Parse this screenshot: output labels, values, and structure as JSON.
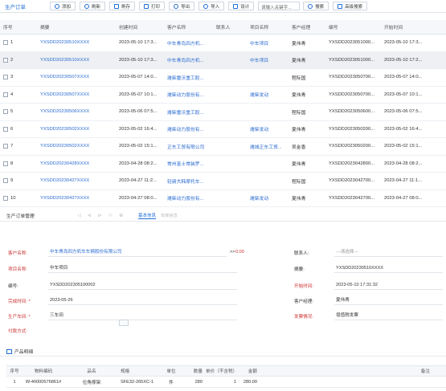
{
  "toolbar": {
    "title": "生产订单",
    "buttons": [
      "添加",
      "刷新",
      "刷存",
      "打印",
      "导出",
      "导入",
      "设计"
    ],
    "search_placeholder": "请输入关键字...",
    "search_button": "搜索",
    "advanced_search": "高级搜索"
  },
  "grid": {
    "headers": {
      "no": "序号",
      "summary": "摘要",
      "created": "创建时间",
      "customer": "客户名称",
      "contact": "联系人",
      "project": "项目名称",
      "manager": "客户经理",
      "code": "编号",
      "start": "开始时间"
    },
    "rows": [
      {
        "no": "1",
        "summary": "YXSDD20230510XXXX",
        "created": "2023-05-10 17:3...",
        "customer": "中车青岛四方机...",
        "contact": "",
        "project": "中车项目",
        "manager": "夏伟青",
        "code": "YXSDD2023051000...",
        "start": "2023-05-10 17:3...",
        "selected": false
      },
      {
        "no": "2",
        "summary": "YXSDD20230510XXXX",
        "created": "2023-05-10 17:3...",
        "customer": "中车青岛四方机...",
        "contact": "",
        "project": "中车项目",
        "manager": "夏伟青",
        "code": "YXSDD2023051000...",
        "start": "2023-05-10 17:2...",
        "selected": true
      },
      {
        "no": "3",
        "summary": "YXSDD20230507XXXX",
        "created": "2023-05-07 14:0...",
        "customer": "潍柴雷沃重工股...",
        "contact": "",
        "project": "",
        "manager": "程际国",
        "code": "YXSDD2023050700...",
        "start": "2023-05-07 14:0...",
        "selected": false
      },
      {
        "no": "4",
        "summary": "YXSDD20230507XXXX",
        "created": "2023-05-07 10:1...",
        "customer": "潍柴动力股份有...",
        "contact": "",
        "project": "潍柴发动",
        "manager": "夏伟青",
        "code": "YXSDD2023050700...",
        "start": "2023-05-07 10:1...",
        "selected": false
      },
      {
        "no": "5",
        "summary": "YXSDD20230506XXXX",
        "created": "2023-05-06 07:5...",
        "customer": "潍柴雷沃重工股...",
        "contact": "",
        "project": "",
        "manager": "程际国",
        "code": "YXSDD2023050600...",
        "start": "2023-05-06 07:5...",
        "selected": false
      },
      {
        "no": "6",
        "summary": "YXSDD20230502XXXX",
        "created": "2023-05-02 16:4...",
        "customer": "潍柴动力股份有...",
        "contact": "",
        "project": "潍柴发动",
        "manager": "夏伟青",
        "code": "YXSDD2023050200...",
        "start": "2023-05-02 16:4...",
        "selected": false
      },
      {
        "no": "7",
        "summary": "YXSDD20230502XXXX",
        "created": "2023-05-02 15:1...",
        "customer": "正东工贸有限公司",
        "contact": "",
        "project": "潍城正东工贸...",
        "manager": "吴金香",
        "code": "YXSDD2023050200...",
        "start": "2023-05-02 15:1...",
        "selected": false
      },
      {
        "no": "8",
        "summary": "YXSDD20230428XXXX",
        "created": "2023-04-28 08:2...",
        "customer": "常州富士常装罗...",
        "contact": "",
        "project": "",
        "manager": "夏伟青",
        "code": "YXSDD2023042800...",
        "start": "2023-04-28 08:2...",
        "selected": false
      },
      {
        "no": "9",
        "summary": "YXSDD20230427XXXX",
        "created": "2023-04-27 11:2...",
        "customer": "轻骑大韩摩托车...",
        "contact": "",
        "project": "",
        "manager": "程际国",
        "code": "YXSDD2023042700...",
        "start": "2023-04-27 11:1...",
        "selected": false
      },
      {
        "no": "10",
        "summary": "YXSDD20230427XXXX",
        "created": "2023-04-27 08:0...",
        "customer": "潍柴动力股份有...",
        "contact": "",
        "project": "潍柴发动",
        "manager": "夏伟青",
        "code": "YXSDD2023042700...",
        "start": "2023-04-27 08:0...",
        "selected": false
      }
    ]
  },
  "detail": {
    "title": "生产订单管理",
    "icons": [
      "first-icon",
      "prev-icon",
      "next-icon",
      "print-icon",
      "attach-icon"
    ],
    "tab_basic": "基本信息",
    "tab_sub": "安装信息"
  },
  "form": {
    "customer_label": "客户名称:",
    "customer_value": "中车青岛四方机车车辆股份有限公司",
    "arrow": ">>",
    "amount": "0.00",
    "contact_label": "联系人:",
    "contact_placeholder": "---请选择---",
    "project_label": "项目名称:",
    "project_value": "中车项目",
    "summary_label": "摘要:",
    "summary_value": "YXSDD20230510XXXX",
    "code_label": "编号:",
    "code_value": "YXSDD202305100002",
    "start_label": "开始时间:",
    "start_value": "2023-05-10 17:31:32",
    "finish_label": "完成时间: *",
    "finish_value": "2023-05-26",
    "manager_label": "客户经理:",
    "manager_value": "夏伟青",
    "workshop_label": "生产车间: *",
    "workshop_value": "三车间",
    "invoice_label": "发票情况:",
    "invoice_value": "增值税发票",
    "payment_label": "付款方式:",
    "payment_value": ""
  },
  "products": {
    "title": "产品明细",
    "headers": [
      "序号",
      "物料编码",
      "品名",
      "规格",
      "单位",
      "数量",
      "单价（不含税）",
      "金额",
      "备注"
    ],
    "rows": [
      [
        "1",
        "W-40000576861#",
        "位角撑架",
        "SFE32-265XC-1",
        "件",
        "280",
        "1",
        "280.00",
        ""
      ]
    ]
  }
}
